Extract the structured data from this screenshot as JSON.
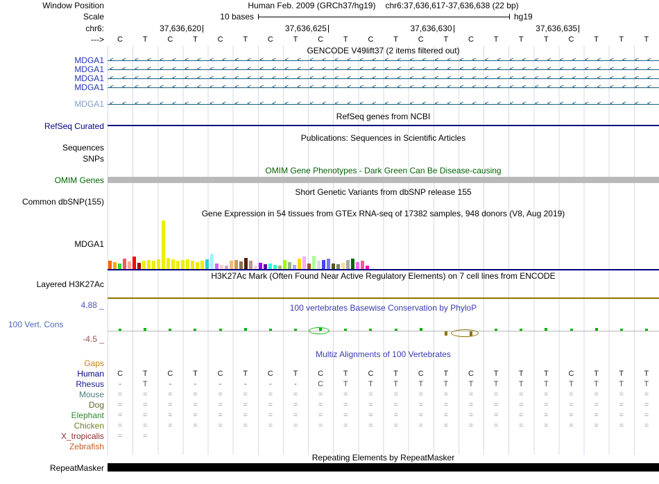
{
  "header": {
    "window_position_label": "Window Position",
    "assembly_line": "Human Feb. 2009 (GRCh37/hg19)",
    "position_line": "chr6:37,636,617-37,636,638 (22 bp)",
    "assembly_tag": "hg19",
    "scale_label": "Scale",
    "scale_text": "10 bases",
    "chrom_label": "chr6:",
    "strand_label": "--->"
  },
  "ruler": {
    "tick_labels": [
      "37,636,620",
      "37,636,625",
      "37,636,630",
      "37,636,635"
    ],
    "bases": "CTCTCTCTCTCTCTCTTTCTTT"
  },
  "tracks": {
    "gencode": {
      "title": "GENCODE V49lift37 (2 items filtered out)",
      "arrow_glyph": "<",
      "arrow_color": "#1b5e7e",
      "items": [
        {
          "label": "MDGA1",
          "label_color": "#2233bb"
        },
        {
          "label": "MDGA1",
          "label_color": "#2233bb"
        },
        {
          "label": "MDGA1",
          "label_color": "#2233bb"
        },
        {
          "label": "MDGA1",
          "label_color": "#2233bb"
        },
        {
          "label": "MDGA1",
          "label_color": "#7f9bcc"
        }
      ]
    },
    "refseq": {
      "title": "RefSeq genes from NCBI",
      "label": "RefSeq Curated",
      "label_color": "#000080",
      "line_color": "#000080"
    },
    "publications": {
      "title": "Publications: Sequences in Scientific Articles",
      "label_sequences": "Sequences",
      "label_snps": "SNPs"
    },
    "omim": {
      "title": "OMIM Gene Phenotypes - Dark Green Can Be Disease-causing",
      "title_color": "#006400",
      "label": "OMIM Genes",
      "label_color": "#006400",
      "bar_color": "#b9b9b9"
    },
    "dbsnp": {
      "title": "Short Genetic Variants from dbSNP release 155",
      "label": "Common dbSNP(155)"
    },
    "gtex": {
      "title": "Gene Expression in 54 tissues from GTEx RNA-seq of 17382 samples, 948 donors (V8, Aug 2019)",
      "label": "MDGA1",
      "baseline_color": "#000080",
      "heights": [
        12,
        10,
        8,
        15,
        11,
        18,
        9,
        12,
        13,
        12,
        14,
        70,
        16,
        14,
        12,
        13,
        14,
        12,
        10,
        12,
        14,
        22,
        8,
        6,
        5,
        12,
        13,
        11,
        16,
        12,
        5,
        9,
        7,
        8,
        6,
        5,
        13,
        10,
        6,
        15,
        18,
        8,
        19,
        12,
        13,
        15,
        8,
        7,
        9,
        13,
        15,
        10,
        12,
        5
      ],
      "colors": [
        "#FF6600",
        "#FFAA00",
        "#33DD33",
        "#FF5555",
        "#FFAA99",
        "#FF0000",
        "#AA0000",
        "#EEEE00",
        "#EEEE00",
        "#EEEE00",
        "#EEEE00",
        "#EEEE00",
        "#EEEE00",
        "#EEEE00",
        "#EEEE00",
        "#EEEE00",
        "#EEEE00",
        "#EEEE00",
        "#EEEE00",
        "#EEEE00",
        "#33CCCC",
        "#AAEEFF",
        "#CC66FF",
        "#FFCCCC",
        "#CCAACC",
        "#EEBB77",
        "#CC9955",
        "#8B7355",
        "#552200",
        "#BB9988",
        "#FFCCDD",
        "#9900FF",
        "#660099",
        "#22FFDD",
        "#33FFC2",
        "#AABB66",
        "#99FF00",
        "#99BB88",
        "#AAAAFF",
        "#FFD700",
        "#FFAAFF",
        "#995522",
        "#AAFF99",
        "#DDDDDD",
        "#4444FF",
        "#7777FF",
        "#555522",
        "#778855",
        "#FFDD99",
        "#AAAAAA",
        "#006600",
        "#FF66FF",
        "#FF5599",
        "#FF00BB"
      ]
    },
    "h3k27ac": {
      "title": "H3K27Ac Mark (Often Found Near Active Regulatory Elements) on 7 cell lines from ENCODE",
      "label": "Layered H3K27Ac",
      "line_color": "#8b7500"
    },
    "phylop": {
      "title": "100 vertebrates Basewise Conservation by PhyloP",
      "title_color": "#3a3ab4",
      "label": "100 Vert. Cons",
      "label_color": "#4a6ab4",
      "max_label": "4.88 _",
      "max_color": "#5050c8",
      "min_label": "-4.5 _",
      "min_color": "#a05050",
      "pos_color": "#00b400",
      "neg_color": "#8b7500",
      "values": [
        0.15,
        0.3,
        0.1,
        0.15,
        0.1,
        0.2,
        0.12,
        0.15,
        0.25,
        0.1,
        0.15,
        0.1,
        0.2,
        -0.35,
        -0.45,
        0.15,
        0.1,
        0.2,
        0.1,
        0.25,
        0.12,
        0.15
      ]
    },
    "multiz": {
      "title": "Multiz Alignments of 100 Vertebrates",
      "title_color": "#3a3ab4",
      "rows": [
        {
          "label": "Gaps",
          "label_color": "#c8820a",
          "cell_color": "#888888",
          "cells": ""
        },
        {
          "label": "Human",
          "label_color": "#000080",
          "cell_color": "#1a1a1a",
          "cells": "CTCTCTCTCTCTCTCTTTCTTT"
        },
        {
          "label": "Rhesus",
          "label_color": "#1a1a8c",
          "cell_color": "#4a4a4a",
          "cells": "-T------CTTTTTTTTTTTTT"
        },
        {
          "label": "Mouse",
          "label_color": "#4d7d7d",
          "cell_color": "#9a9a9a",
          "cells": "======================"
        },
        {
          "label": "Dog",
          "label_color": "#5a6b2a",
          "cell_color": "#9a9a9a",
          "cells": "======================"
        },
        {
          "label": "Elephant",
          "label_color": "#2e8b2e",
          "cell_color": "#9a9a9a",
          "cells": "======================"
        },
        {
          "label": "Chicken",
          "label_color": "#6b7d23",
          "cell_color": "#9a9a9a",
          "cells": "======================"
        },
        {
          "label": "X_tropicalis",
          "label_color": "#8b2d2d",
          "cell_color": "#9a9a9a",
          "cells": "==                    "
        },
        {
          "label": "Zebrafish",
          "label_color": "#c85a1e",
          "cell_color": "#9a9a9a",
          "cells": ""
        }
      ]
    },
    "repeatmasker": {
      "title": "Repeating Elements by RepeatMasker",
      "label": "RepeatMasker",
      "bar_color": "#000000"
    }
  }
}
